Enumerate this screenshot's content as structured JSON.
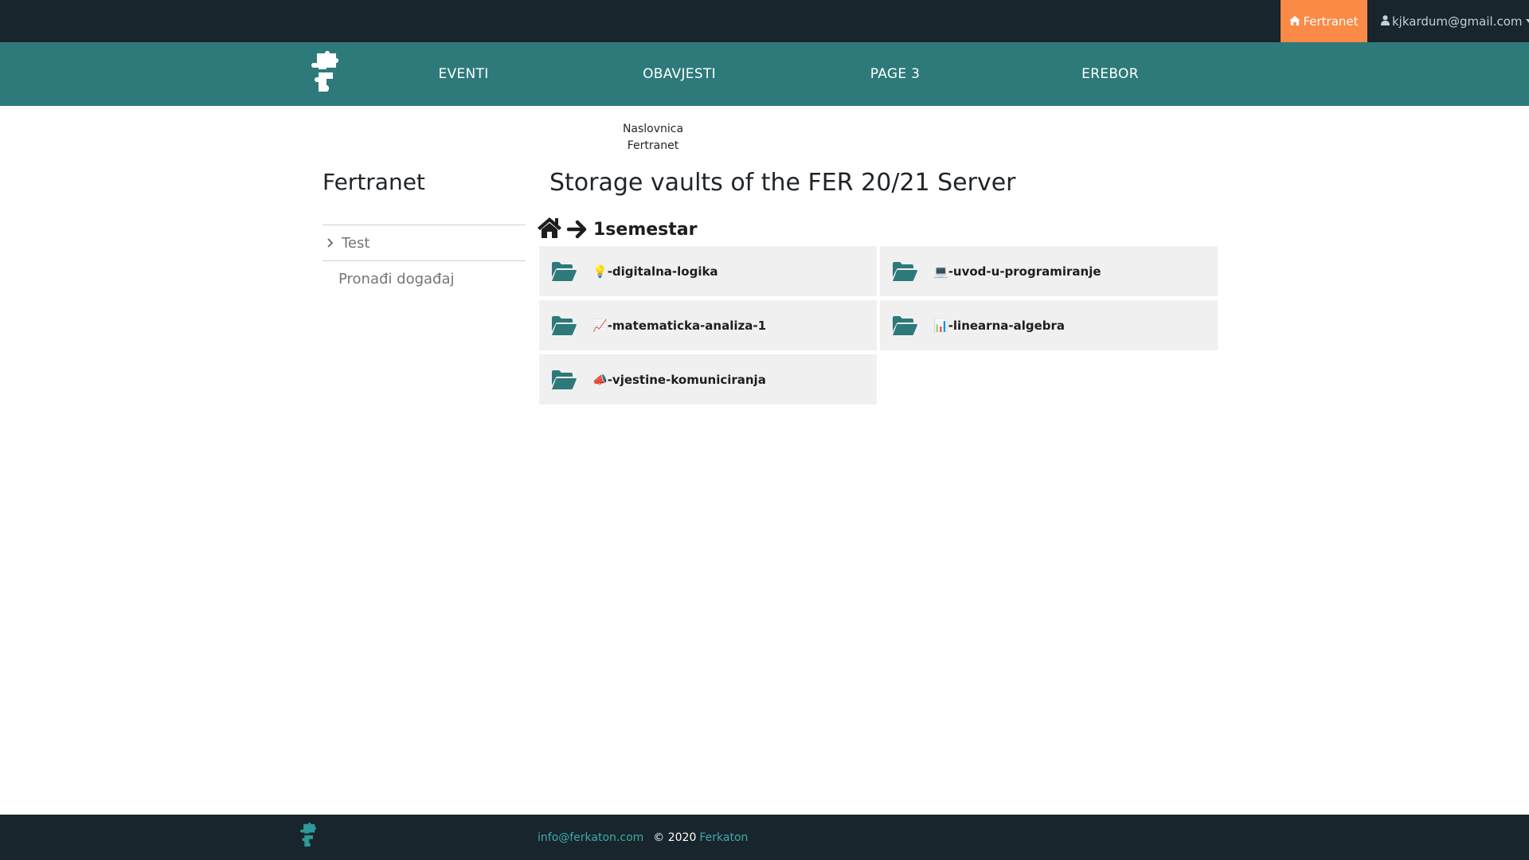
{
  "topbar": {
    "home_label": "Fertranet",
    "user_email": "kjkardum@gmail.com"
  },
  "nav": {
    "links": [
      "EVENTI",
      "OBAVJESTI",
      "PAGE 3",
      "EREBOR"
    ]
  },
  "breadcrumb": {
    "items": [
      "Naslovnica",
      "Fertranet"
    ]
  },
  "sidebar": {
    "title": "Fertranet",
    "items": [
      "Test",
      "Pronađi događaj"
    ]
  },
  "main": {
    "title": "Storage vaults of the FER 20/21 Server",
    "current_folder": "1semestar",
    "folders": [
      {
        "emoji": "💡",
        "name": "-digitalna-logika"
      },
      {
        "emoji": "💻",
        "name": "-uvod-u-programiranje"
      },
      {
        "emoji": "📈",
        "name": "-matematicka-analiza-1"
      },
      {
        "emoji": "📊",
        "name": "-linearna-algebra"
      },
      {
        "emoji": "📣",
        "name": "-vjestine-komuniciranja"
      }
    ]
  },
  "footer": {
    "email": "info@ferkaton.com",
    "copyright": "© 2020",
    "brand": "Ferkaton"
  },
  "colors": {
    "topbar": "#18252c",
    "nav": "#2e7a7a",
    "accent": "#fa8a46",
    "folder_bg": "#f0f0f0",
    "folder_icon": "#2e7a7a",
    "footer_link": "#3fa9a9"
  }
}
